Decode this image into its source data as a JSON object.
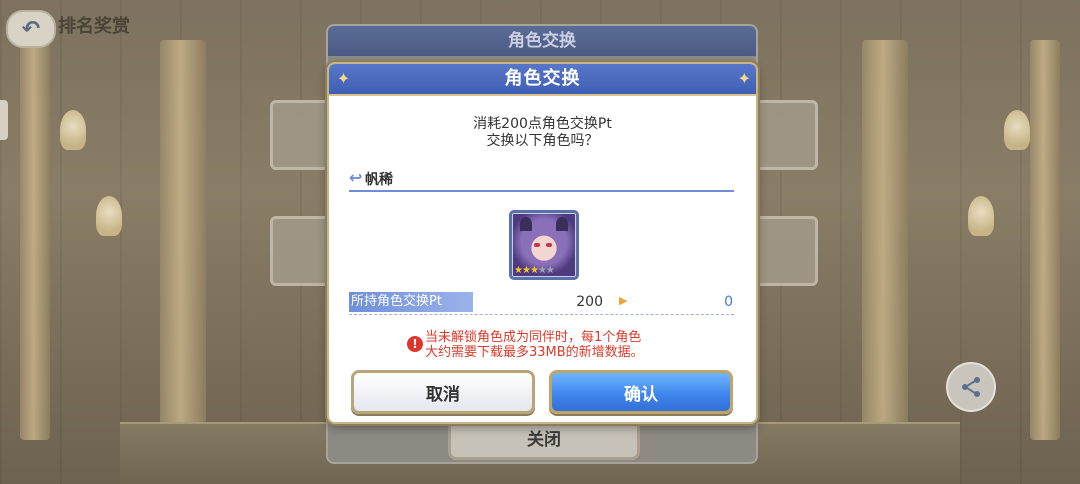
{
  "background": {
    "back_title": "排名奖赏",
    "under_panel_title": "角色交换",
    "under_close_label": "关闭"
  },
  "dialog": {
    "title": "角色交换",
    "message_line1": "消耗200点角色交换Pt",
    "message_line2": "交换以下角色吗？",
    "character_name": "帆稀",
    "character_stars": 3,
    "character_max_stars": 5,
    "pt_label": "所持角色交换Pt",
    "pt_before": "200",
    "pt_after": "0",
    "warning": "当未解锁角色成为同伴时，每1个角色\n大约需要下载最多33MB的新增数据。",
    "cancel_label": "取消",
    "confirm_label": "确认"
  },
  "icons": [
    "back-arrow-icon",
    "share-icon",
    "name-bracket-icon",
    "arrow-right-icon",
    "warning-icon",
    "star-icon"
  ],
  "colors": {
    "header_blue": "#4767bf",
    "confirm_blue": "#3d82ea",
    "warning_red": "#d93a2b",
    "pt_after_blue": "#4a78d6",
    "gold_border": "#c7b58a"
  }
}
